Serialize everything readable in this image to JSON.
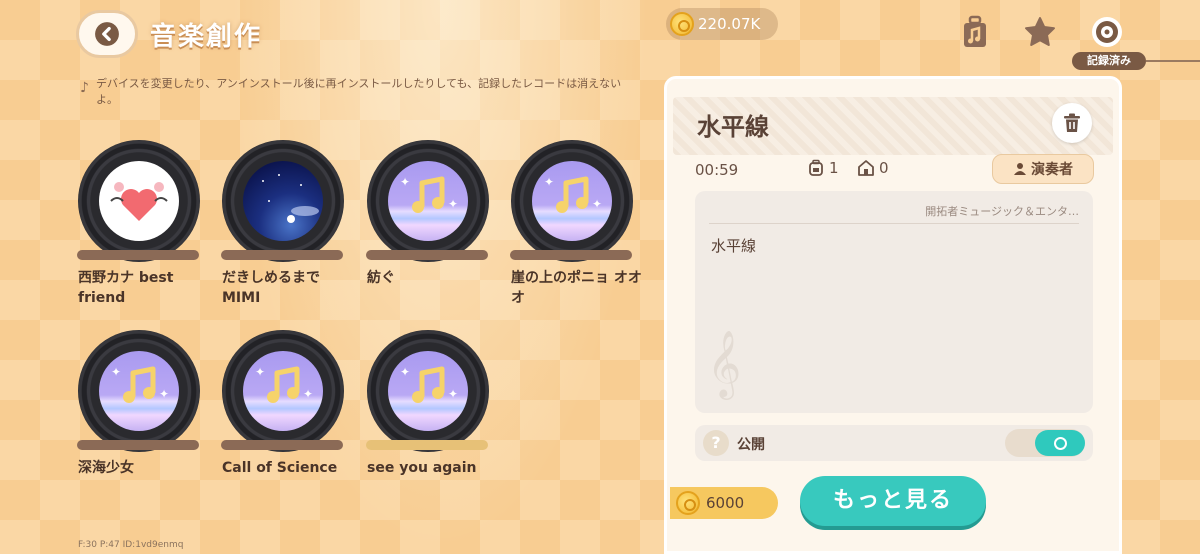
{
  "header": {
    "title": "音楽創作",
    "notice": "デバイスを変更したり、アンインストール後に再インストールしたりしても、記録したレコードは消えないよ。"
  },
  "currency": {
    "coins": "220.07K"
  },
  "top_tabs": {
    "active_label": "記録済み"
  },
  "records": [
    {
      "title": "西野カナ best friend",
      "art": "heart"
    },
    {
      "title": "だきしめるまで MIMI",
      "art": "night"
    },
    {
      "title": "紡ぐ",
      "art": "music"
    },
    {
      "title": "崖の上のポニョ オオオ",
      "art": "music"
    },
    {
      "title": "深海少女",
      "art": "music"
    },
    {
      "title": "Call of Science",
      "art": "music"
    },
    {
      "title": "see you again",
      "art": "music"
    }
  ],
  "detail": {
    "name": "水平線",
    "duration": "00:59",
    "stat_a": "1",
    "stat_b": "0",
    "player_label": "演奏者",
    "author": "開拓者ミュージック＆エンタ…",
    "description": "水平線",
    "public_label": "公開",
    "public_help": "?",
    "public_on": true,
    "cost": "6000",
    "more_label": "もっと見る"
  },
  "debug": "F:30  P:47  ID:1vd9enmq",
  "colors": {
    "accent": "#38c9be",
    "brown": "#5a4236",
    "bg": "#f8cd92"
  }
}
